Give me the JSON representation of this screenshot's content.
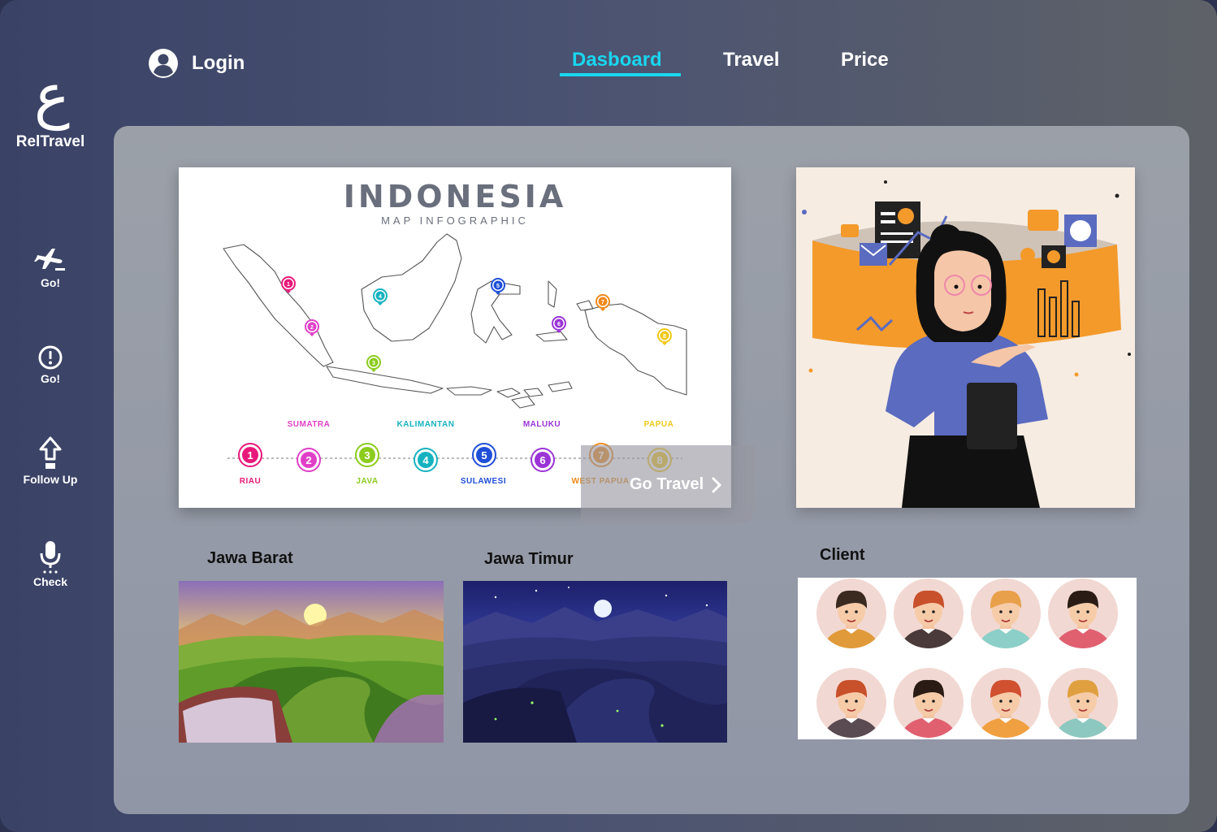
{
  "brand": {
    "logo_glyph": "ع",
    "name": "RelTravel"
  },
  "sidebar": {
    "items": [
      {
        "label": "Go!",
        "icon": "airplane-icon"
      },
      {
        "label": "Go!",
        "icon": "alert-circle-icon"
      },
      {
        "label": "Follow Up",
        "icon": "arrow-up-icon"
      },
      {
        "label": "Check",
        "icon": "microphone-icon"
      }
    ]
  },
  "header": {
    "login_label": "Login",
    "tabs": [
      {
        "label": "Dasboard",
        "active": true
      },
      {
        "label": "Travel",
        "active": false
      },
      {
        "label": "Price",
        "active": false
      }
    ]
  },
  "map_card": {
    "title": "INDONESIA",
    "subtitle": "MAP INFOGRAPHIC",
    "regions": [
      {
        "num": "1",
        "name": "RIAU",
        "color": "#e8197a"
      },
      {
        "num": "2",
        "name": "SUMATRA",
        "color": "#e040c8"
      },
      {
        "num": "3",
        "name": "JAVA",
        "color": "#8ccc1e"
      },
      {
        "num": "4",
        "name": "KALIMANTAN",
        "color": "#16b2c0"
      },
      {
        "num": "5",
        "name": "SULAWESI",
        "color": "#1f4fd8"
      },
      {
        "num": "6",
        "name": "MALUKU",
        "color": "#9b34d6"
      },
      {
        "num": "7",
        "name": "WEST PAPUA",
        "color": "#f08a1c"
      },
      {
        "num": "8",
        "name": "PAPUA",
        "color": "#f2c81a"
      }
    ],
    "cta_label": "Go Travel"
  },
  "destinations": [
    {
      "title": "Jawa Barat",
      "scene": "sunset-rice-terrace"
    },
    {
      "title": "Jawa Timur",
      "scene": "night-rice-terrace"
    }
  ],
  "clients": {
    "title": "Client",
    "count": 8
  },
  "colors": {
    "accent": "#19d7f0",
    "panel": "#9aa0aa"
  }
}
